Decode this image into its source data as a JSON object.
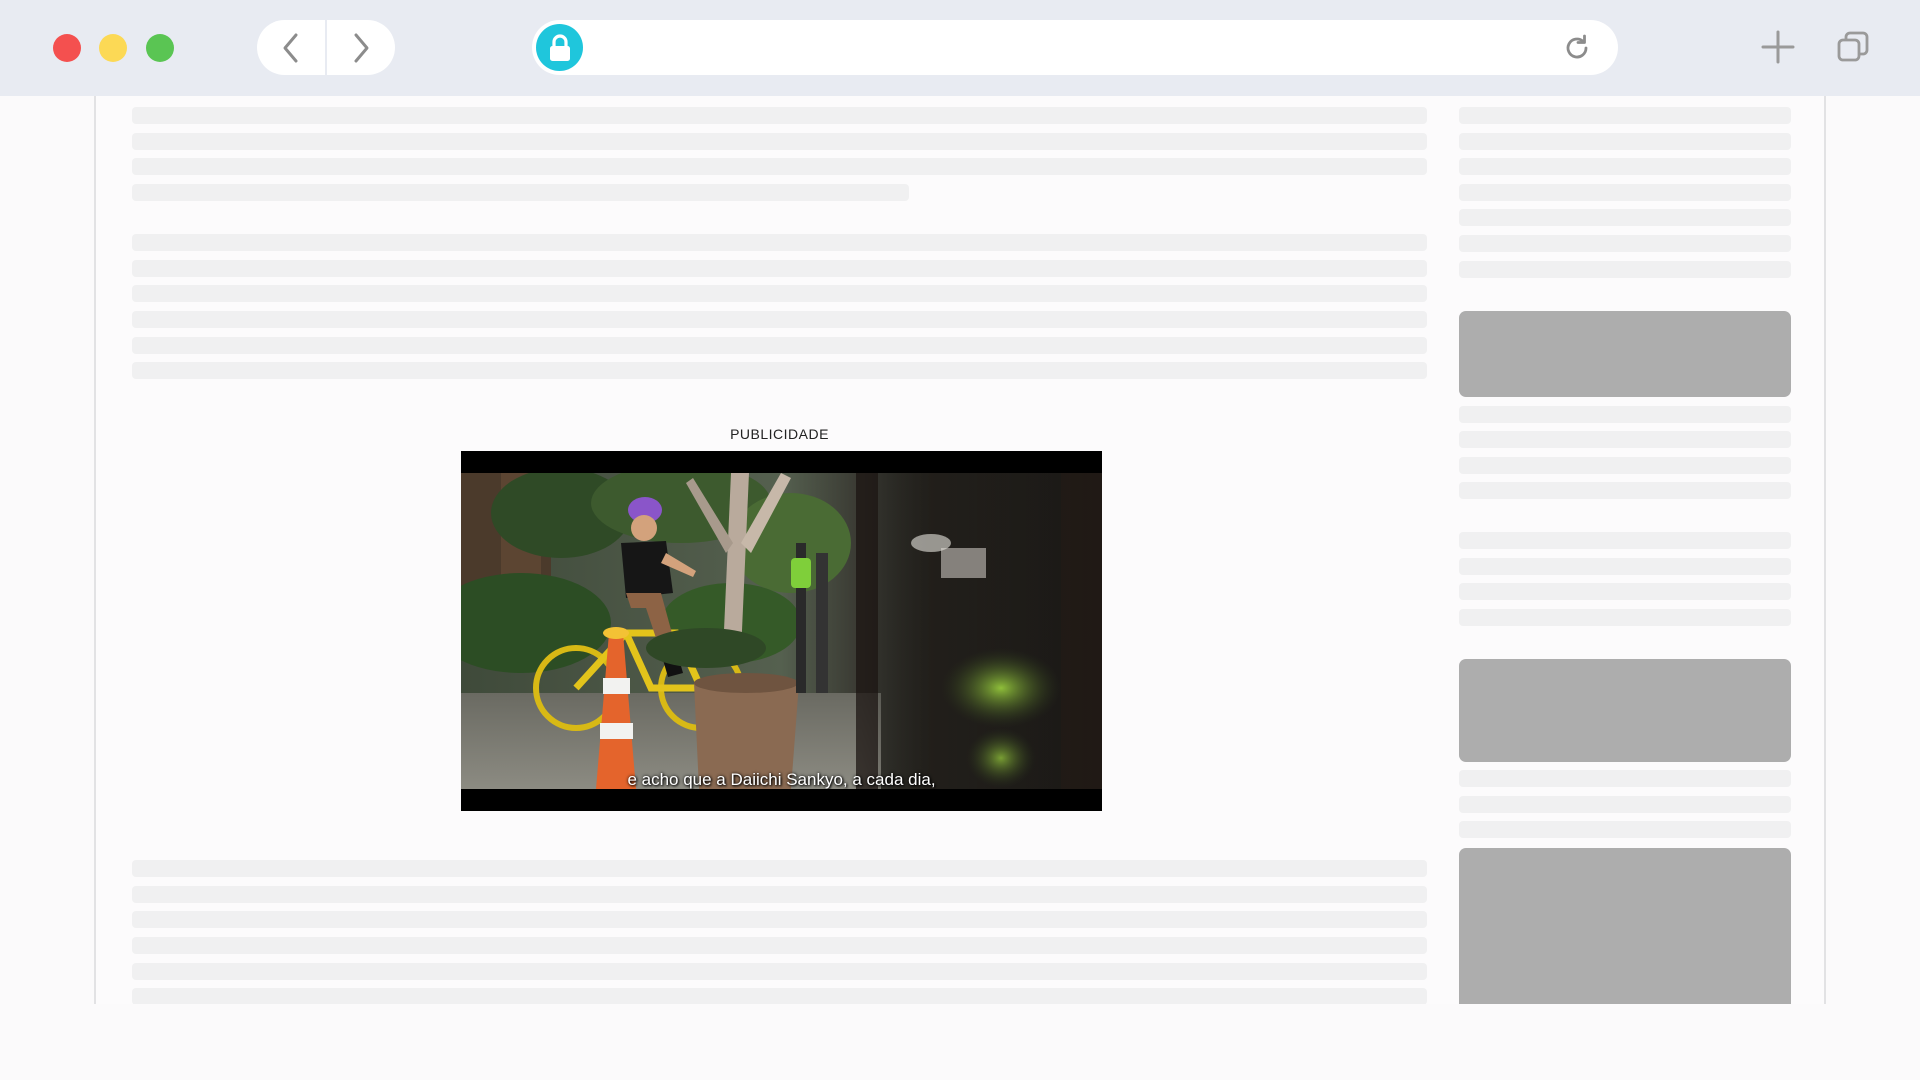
{
  "browser": {
    "window_controls": [
      "close",
      "minimize",
      "maximize"
    ],
    "nav": {
      "back_icon": "chevron-left-icon",
      "forward_icon": "chevron-right-icon"
    },
    "address_bar": {
      "url": "",
      "lock_icon": "lock-icon",
      "reload_icon": "reload-icon"
    },
    "toolbar_right": [
      "plus-icon",
      "tabs-icon"
    ],
    "colors": {
      "close": "#f4504f",
      "minimize": "#fcd955",
      "maximize": "#5ac553",
      "lock": "#1fc6dc"
    }
  },
  "ad": {
    "label": "PUBLICIDADE",
    "video": {
      "subtitle": "e acho que a Daiichi Sankyo, a cada dia,"
    }
  }
}
